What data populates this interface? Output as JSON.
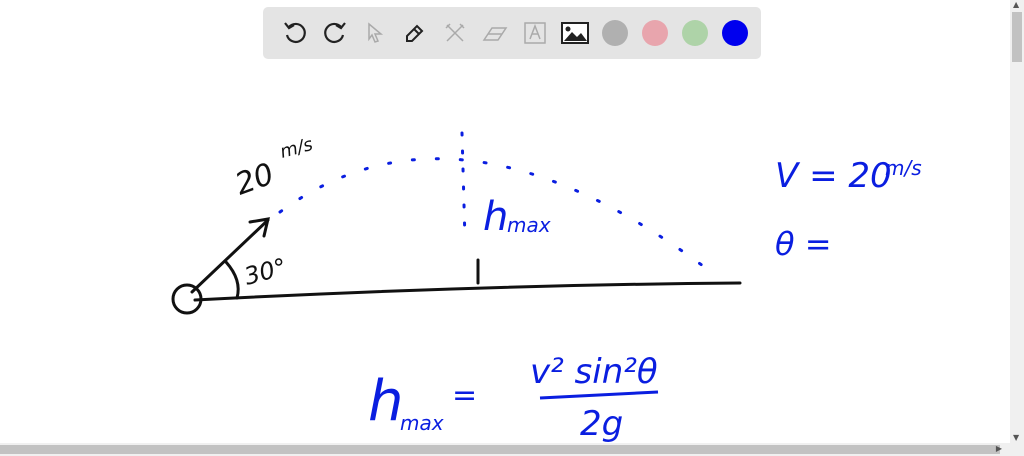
{
  "toolbar": {
    "tools": [
      {
        "name": "undo-icon",
        "glyph": "↶"
      },
      {
        "name": "redo-icon",
        "glyph": "↷"
      },
      {
        "name": "select-icon"
      },
      {
        "name": "pen-icon"
      },
      {
        "name": "tools-icon"
      },
      {
        "name": "eraser-icon"
      },
      {
        "name": "text-icon",
        "glyph": "A"
      },
      {
        "name": "image-icon"
      }
    ],
    "colors": [
      "#b0b0b0",
      "#e8a5ad",
      "#aed3a8",
      "#0000ee"
    ]
  },
  "drawing": {
    "velocity_label": "20",
    "velocity_unit": "m/s",
    "angle_label": "30°",
    "hmax_label": "h",
    "hmax_sub": "max",
    "given_v": "V = 20",
    "given_v_unit": "m/s",
    "given_theta": "θ =",
    "formula_lhs": "h",
    "formula_lhs_sub": "max",
    "formula_eq": "=",
    "formula_num": "v² sin²θ",
    "formula_den": "2g",
    "ink_black": "#111111",
    "ink_blue": "#0a1ee0"
  }
}
